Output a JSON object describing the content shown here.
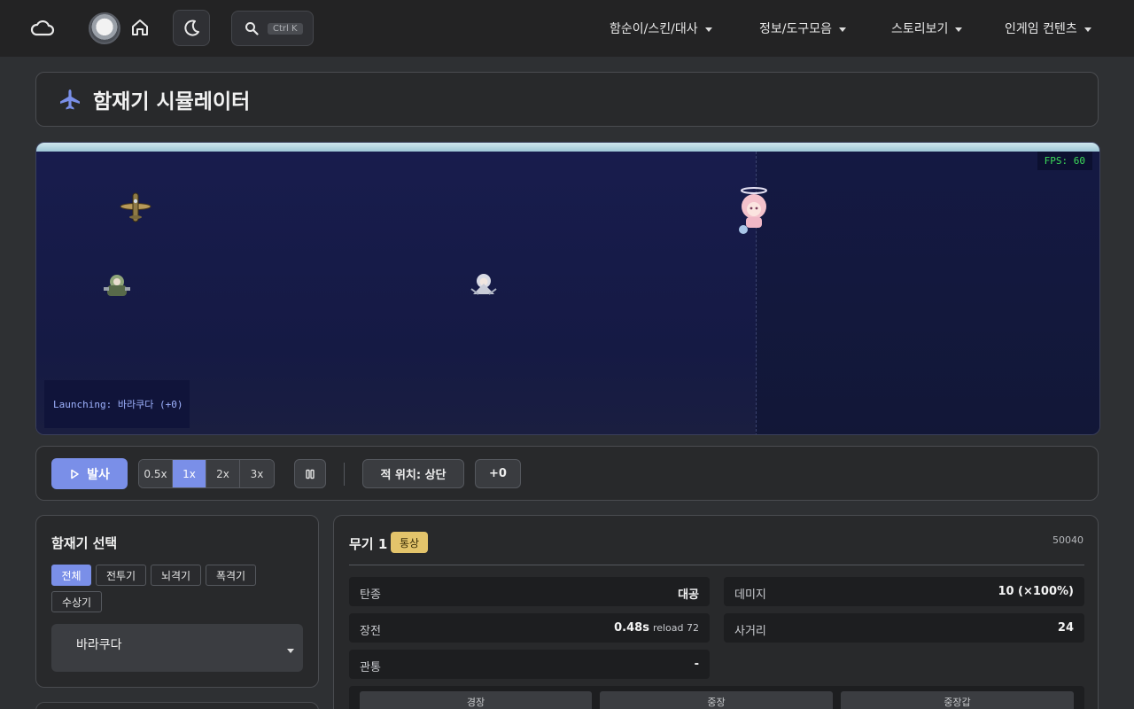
{
  "nav": {
    "search_shortcut": "Ctrl K",
    "menus": [
      "함순이/스킨/대사",
      "정보/도구모음",
      "스토리보기",
      "인게임 컨텐츠"
    ]
  },
  "title": {
    "text": "함재기 시뮬레이터",
    "icon": "plane-icon"
  },
  "simulator": {
    "fps_label": "FPS: 60",
    "launch_label": "Launching: 바라쿠다 (+0)"
  },
  "controls": {
    "fire_label": "발사",
    "speeds": [
      "0.5x",
      "1x",
      "2x",
      "3x"
    ],
    "active_speed": "1x",
    "enemy_position_label": "적 위치: 상단",
    "plus_label": "+0"
  },
  "aircraft_select": {
    "heading": "함재기 선택",
    "filters": [
      "전체",
      "전투기",
      "뇌격기",
      "폭격기",
      "수상기"
    ],
    "active_filter": "전체",
    "selected": "바라쿠다"
  },
  "weapon": {
    "title": "무기 1",
    "badge": "통상",
    "id": "50040",
    "stats": {
      "ammo_label": "탄종",
      "ammo_value": "대공",
      "damage_label": "데미지",
      "damage_value": "10 (×100%)",
      "reload_label": "장전",
      "reload_value": "0.48s",
      "reload_note": "reload 72",
      "range_label": "사거리",
      "range_value": "24",
      "pierce_label": "관통",
      "pierce_value": "-"
    },
    "armor_types": [
      "경장",
      "중장",
      "중장갑"
    ]
  },
  "colors": {
    "accent": "#7a8fe8",
    "badge": "#e3c46b",
    "fps_text": "#3ddc5a"
  }
}
